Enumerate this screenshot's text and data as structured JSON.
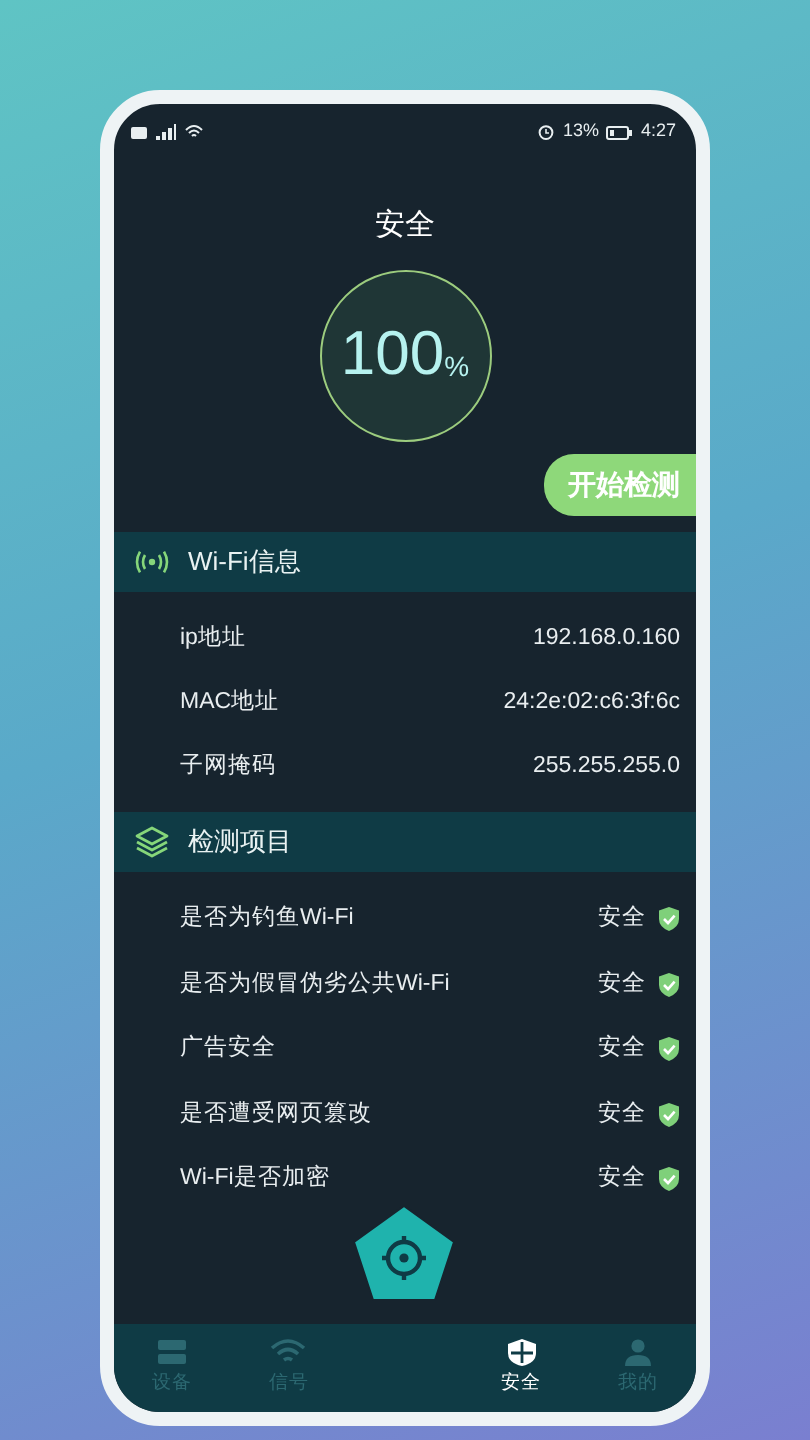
{
  "status_bar": {
    "battery": "13%",
    "time": "4:27"
  },
  "header": {
    "title": "安全",
    "score": "100",
    "unit": "%",
    "scan_button": "开始检测"
  },
  "wifi_info": {
    "title": "Wi-Fi信息",
    "rows": [
      {
        "label": "ip地址",
        "value": "192.168.0.160"
      },
      {
        "label": "MAC地址",
        "value": "24:2e:02:c6:3f:6c"
      },
      {
        "label": "子网掩码",
        "value": "255.255.255.0"
      }
    ]
  },
  "checks": {
    "title": "检测项目",
    "items": [
      {
        "label": "是否为钓鱼Wi-Fi",
        "result": "安全",
        "safe": true
      },
      {
        "label": "是否为假冒伪劣公共Wi-Fi",
        "result": "安全",
        "safe": true
      },
      {
        "label": "广告安全",
        "result": "安全",
        "safe": true
      },
      {
        "label": "是否遭受网页篡改",
        "result": "安全",
        "safe": true
      },
      {
        "label": "Wi-Fi是否加密",
        "result": "安全",
        "safe": true
      }
    ]
  },
  "bottom_nav": [
    {
      "label": "设备",
      "selected": false
    },
    {
      "label": "信号",
      "selected": false
    },
    {
      "label": "安全",
      "selected": true
    },
    {
      "label": "我的",
      "selected": false
    }
  ]
}
